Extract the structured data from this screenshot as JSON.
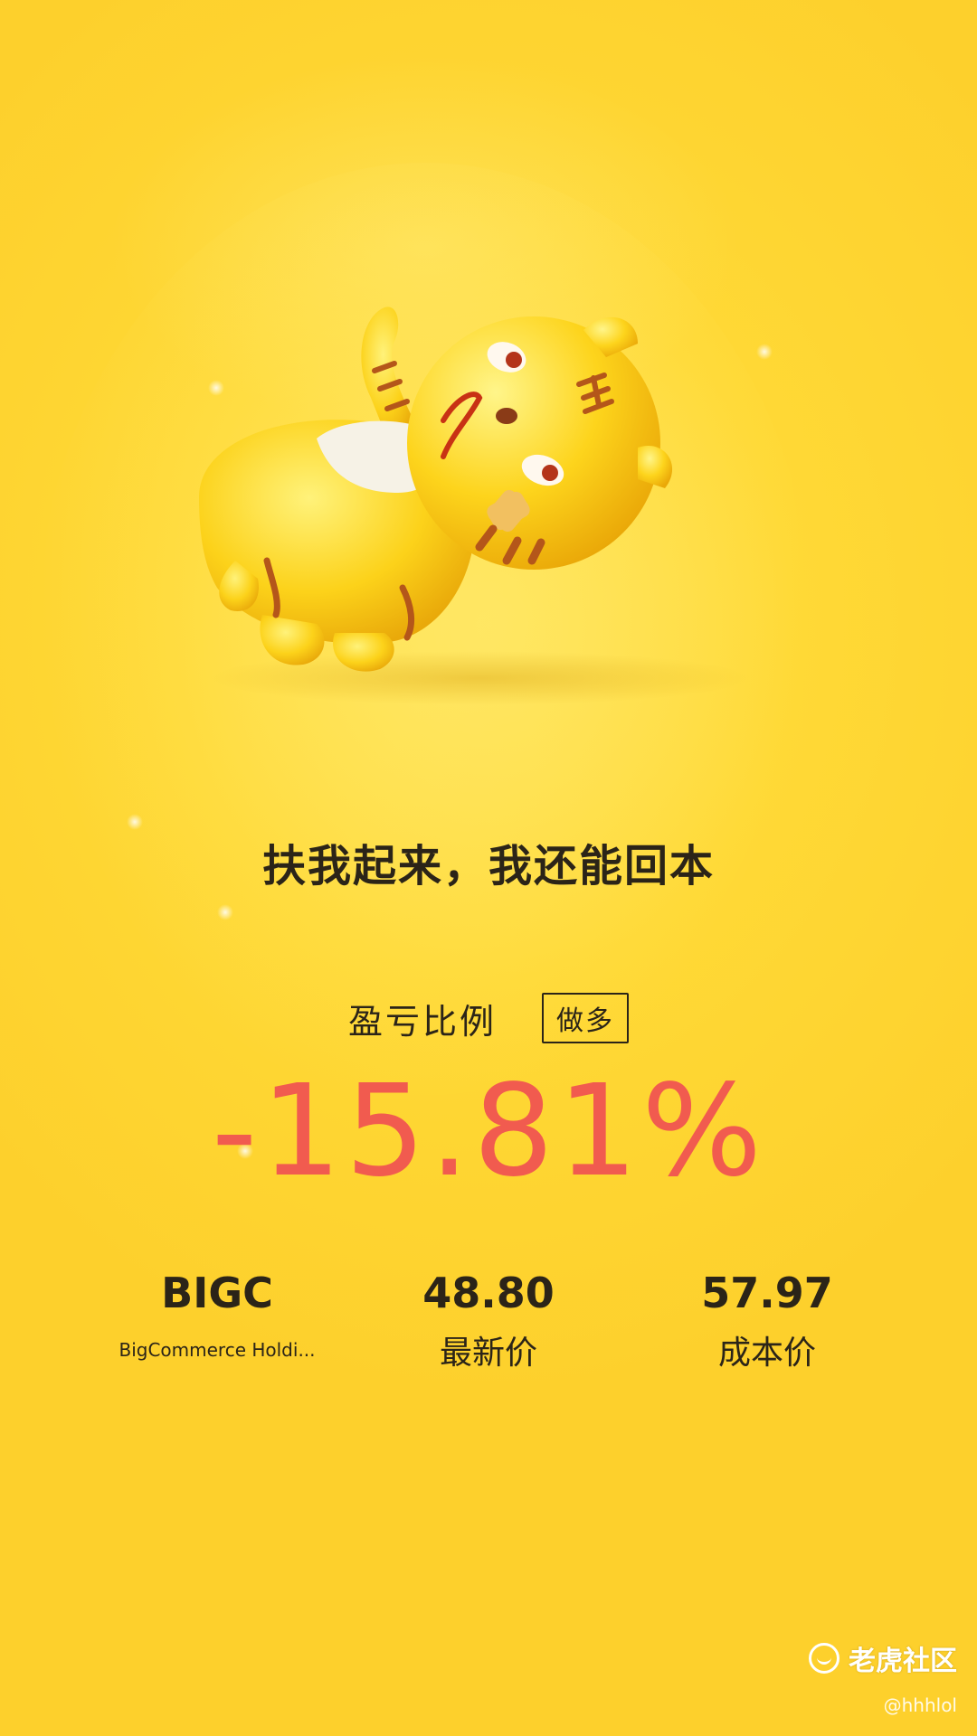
{
  "headline": "扶我起来，我还能回本",
  "pnl": {
    "label": "盈亏比例",
    "direction": "做多",
    "percent": "-15.81%",
    "percent_color": "#f15b4f"
  },
  "stats": {
    "symbol": "BIGC",
    "company": "BigCommerce Holdi...",
    "last_price_value": "48.80",
    "last_price_label": "最新价",
    "cost_price_value": "57.97",
    "cost_price_label": "成本价"
  },
  "brand": {
    "name": "老虎社区",
    "user": "@hhhlol"
  },
  "colors": {
    "background": "#fdd02c",
    "text": "#2b2418"
  }
}
